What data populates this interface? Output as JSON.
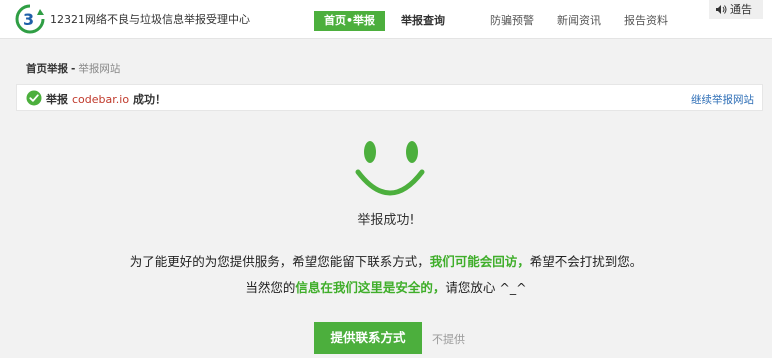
{
  "header": {
    "site_title": "12321网络不良与垃圾信息举报受理中心",
    "nav": {
      "home_report": "首页•举报",
      "report_query": "举报查询",
      "fraud_warning": "防骗预警",
      "news": "新闻资讯",
      "reports": "报告资料"
    },
    "notice_label": "通告"
  },
  "breadcrumb": {
    "home": "首页举报",
    "separator": "-",
    "current": "举报网站"
  },
  "success_bar": {
    "prefix": "举报",
    "domain": "codebar.io",
    "suffix": "成功！",
    "continue_link": "继续举报网站"
  },
  "main": {
    "result_title": "举报成功!",
    "line1": {
      "part1": "为了能更好的为您提供服务，希望您能留下联系方式，",
      "highlight": "我们可能会回访，",
      "part2": "希望不会打扰到您。"
    },
    "line2": {
      "part1": "当然您的",
      "highlight": "信息在我们这里是安全的，",
      "part2": "请您放心 ^_^"
    },
    "provide_button": "提供联系方式",
    "decline_link": "不提供"
  },
  "colors": {
    "brand_green": "#4caf3d",
    "highlight_green": "#3fae2a",
    "link_blue": "#2f6fb7",
    "domain_red": "#c0392b"
  },
  "icons": {
    "logo": "12321-logo",
    "notice": "speaker-icon",
    "success": "check-circle-icon",
    "result": "smiley-icon"
  }
}
